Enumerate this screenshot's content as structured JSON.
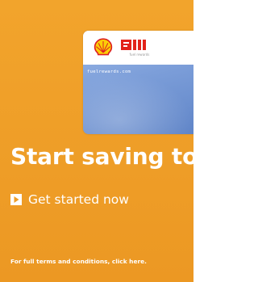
{
  "banner": {
    "headline": "Start saving to",
    "cta_label": "Get started now",
    "terms_link": "For full terms and conditions, click here.",
    "background_color": "#EE9D27"
  },
  "card": {
    "url_text": "fuelrewards.com",
    "partner_logo_text": "fuel rewards",
    "logos": [
      "shell-logo",
      "partner-logo"
    ],
    "colors": {
      "top": "#FFFFFF",
      "body": "#7C9ED9",
      "shell_red": "#DD1D21",
      "shell_yellow": "#FBCE07"
    }
  },
  "icons": {
    "cta": "play-arrow-icon"
  }
}
